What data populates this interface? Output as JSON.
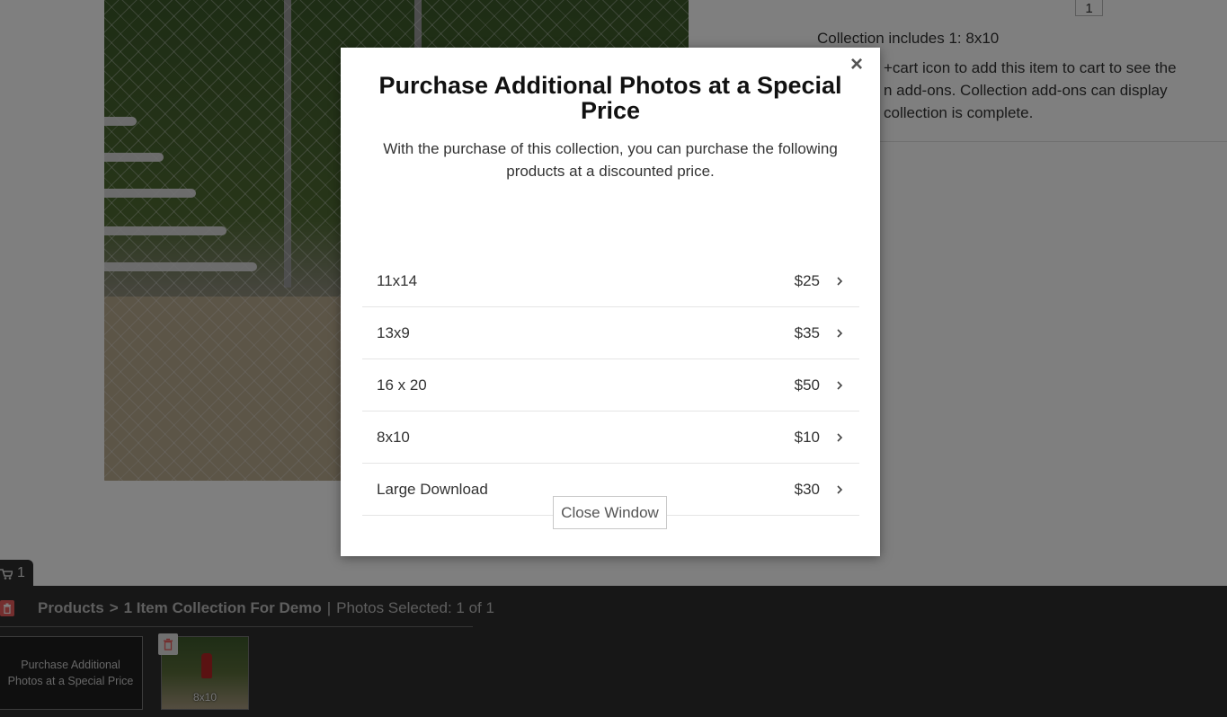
{
  "background": {
    "quantity_value": "1",
    "collection_includes": "Collection includes 1: 8x10",
    "cart_hint_lines": [
      "+cart icon to add this item to cart to see the",
      "n add-ons. Collection add-ons can display",
      "collection is complete."
    ]
  },
  "tray": {
    "cart_count": "1",
    "breadcrumb_products": "Products",
    "breadcrumb_arrow": ">",
    "breadcrumb_collection": "1 Item Collection For Demo",
    "breadcrumb_divider": "|",
    "photos_selected": "Photos Selected: 1 of 1",
    "addon_thumb_label": "Purchase Additional Photos at a Special Price",
    "photo_thumb_label": "8x10"
  },
  "modal": {
    "close_symbol": "×",
    "title": "Purchase Additional Photos at a Special Price",
    "description": "With the purchase of this collection, you can purchase the following products at a discounted price.",
    "products": [
      {
        "name": "11x14",
        "price": "$25"
      },
      {
        "name": "13x9",
        "price": "$35"
      },
      {
        "name": "16 x 20",
        "price": "$50"
      },
      {
        "name": "8x10",
        "price": "$10"
      },
      {
        "name": "Large Download",
        "price": "$30"
      }
    ],
    "close_window_label": "Close Window"
  },
  "colors": {
    "overlay": "rgba(0,0,0,0.5)",
    "tray_bg": "#2e2e2e",
    "trash_red": "#e85d5d"
  }
}
